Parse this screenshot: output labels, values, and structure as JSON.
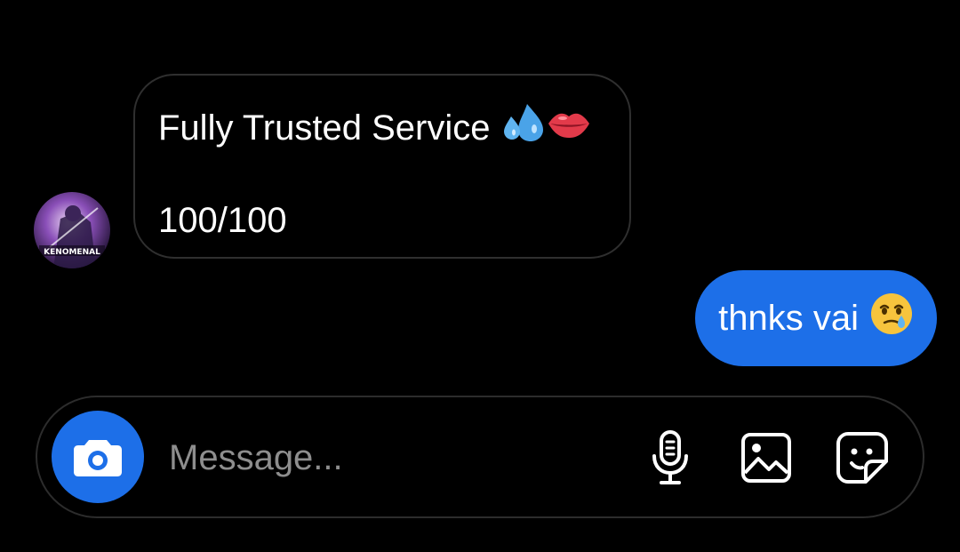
{
  "thread": {
    "incoming": {
      "line1": "Fully Trusted Service",
      "line1_emojis": [
        "sweat-droplets-emoji",
        "lips-emoji"
      ],
      "line2": "100/100",
      "avatar_caption": "KENOMENAL"
    },
    "outgoing": {
      "text": "thnks vai",
      "emoji": "face-holding-back-tears-emoji"
    }
  },
  "composer": {
    "placeholder": "Message...",
    "value": "",
    "icons": [
      "camera-icon",
      "microphone-icon",
      "gallery-icon",
      "sticker-icon"
    ]
  },
  "colors": {
    "background": "#000000",
    "accent": "#1d6fe8",
    "bubble_border": "#2f2f2f",
    "placeholder": "#8e8e8e",
    "text": "#ffffff"
  }
}
